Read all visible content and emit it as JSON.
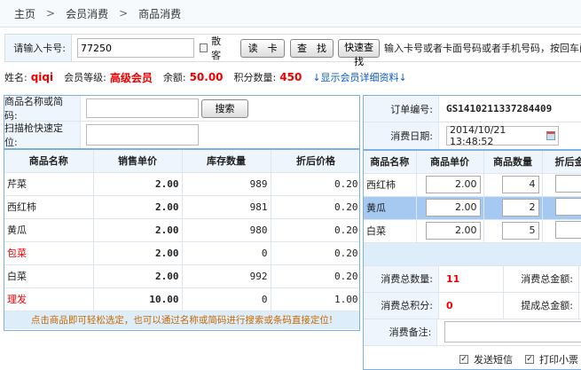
{
  "breadcrumb": [
    "主页",
    "会员消费",
    "商品消费"
  ],
  "card": {
    "label": "请输入卡号:",
    "value": "77250",
    "walkin_label": "散客",
    "read_btn": "读　卡",
    "find_btn": "查　找",
    "quick_btn": "快速查找",
    "hint": "输入卡号或者卡面号码或者手机号码，按回车阅"
  },
  "member": {
    "name_label": "姓名:",
    "name": "qiqi",
    "level_label": "会员等级:",
    "level": "高级会员",
    "balance_label": "余额:",
    "balance": "50.00",
    "points_label": "积分数量:",
    "points": "450",
    "detail_link": "↓显示会员详细资料↓"
  },
  "left": {
    "search_label": "商品名称或简码:",
    "search_value": "",
    "search_btn": "搜索",
    "scan_label": "扫描枪快速定位:",
    "scan_value": "",
    "columns": [
      "商品名称",
      "销售单价",
      "库存数量",
      "折后价格"
    ],
    "rows": [
      {
        "name": "芹菜",
        "price": "2.00",
        "stock": "989",
        "disc": "0.20",
        "red": false
      },
      {
        "name": "西红柿",
        "price": "2.00",
        "stock": "981",
        "disc": "0.20",
        "red": false
      },
      {
        "name": "黄瓜",
        "price": "2.00",
        "stock": "980",
        "disc": "0.20",
        "red": false
      },
      {
        "name": "包菜",
        "price": "2.00",
        "stock": "0",
        "disc": "0.20",
        "red": true
      },
      {
        "name": "白菜",
        "price": "2.00",
        "stock": "992",
        "disc": "0.20",
        "red": false
      },
      {
        "name": "理发",
        "price": "10.00",
        "stock": "0",
        "disc": "1.00",
        "red": true
      }
    ],
    "tip": "点击商品即可轻松选定，也可以通过名称或简码进行搜索或条码直接定位!"
  },
  "right": {
    "order_label": "订单编号:",
    "order_no": "GS1410211337284409",
    "date_label": "消费日期:",
    "date": "2014/10/21 13:48:52",
    "columns": [
      "商品名称",
      "商品单价",
      "商品数量",
      "折后金"
    ],
    "rows": [
      {
        "name": "西红柿",
        "price": "2.00",
        "qty": "4"
      },
      {
        "name": "黄瓜",
        "price": "2.00",
        "qty": "2"
      },
      {
        "name": "白菜",
        "price": "2.00",
        "qty": "5"
      }
    ],
    "total_qty_label": "消费总数量:",
    "total_qty": "11",
    "total_amt_label": "消费总金额:",
    "total_points_label": "消费总积分:",
    "total_points": "0",
    "commission_label": "提成总金额:",
    "remark_label": "消费备注:",
    "sms_label": "发送短信",
    "print_label": "打印小票"
  }
}
